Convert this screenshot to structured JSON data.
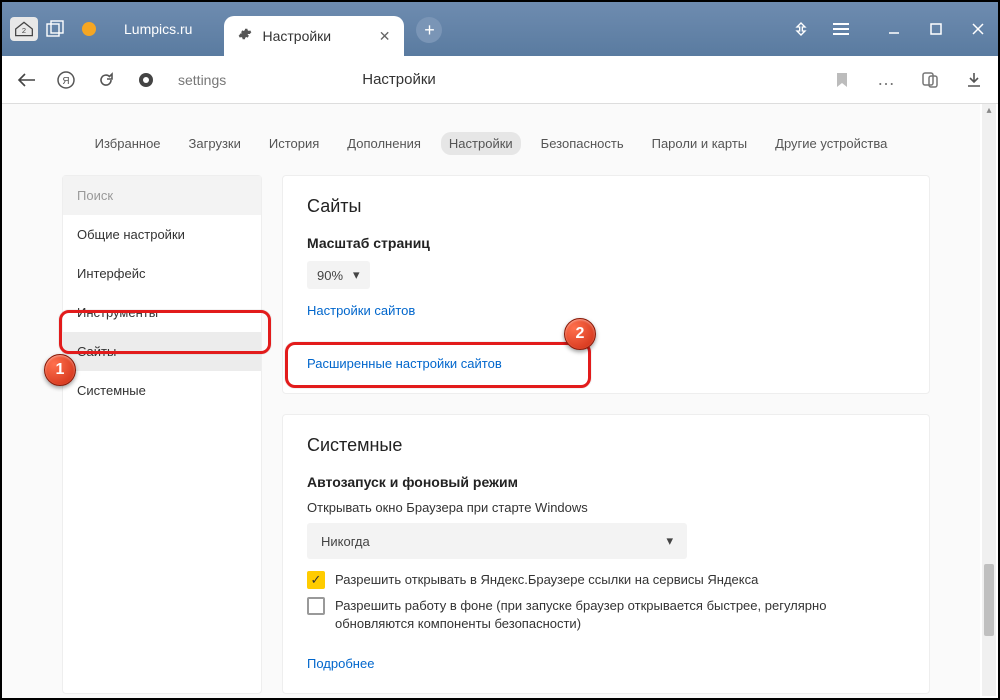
{
  "titlebar": {
    "home_badge": "2",
    "site_title": "Lumpics.ru",
    "active_tab": "Настройки"
  },
  "addressbar": {
    "url": "settings",
    "page_title": "Настройки"
  },
  "topnav": {
    "items": [
      "Избранное",
      "Загрузки",
      "История",
      "Дополнения",
      "Настройки",
      "Безопасность",
      "Пароли и карты",
      "Другие устройства"
    ],
    "active_index": 4
  },
  "sidebar": {
    "search_placeholder": "Поиск",
    "items": [
      "Общие настройки",
      "Интерфейс",
      "Инструменты",
      "Сайты",
      "Системные"
    ],
    "selected_index": 3
  },
  "sites_panel": {
    "title": "Сайты",
    "zoom_label": "Масштаб страниц",
    "zoom_value": "90%",
    "sites_settings_link": "Настройки сайтов",
    "advanced_link": "Расширенные настройки сайтов"
  },
  "system_panel": {
    "title": "Системные",
    "autostart_heading": "Автозапуск и фоновый режим",
    "autostart_label": "Открывать окно Браузера при старте Windows",
    "autostart_value": "Никогда",
    "allow_yandex_links": "Разрешить открывать в Яндекс.Браузере ссылки на сервисы Яндекса",
    "allow_background": "Разрешить работу в фоне (при запуске браузер открывается быстрее, регулярно обновляются компоненты безопасности)",
    "more_link": "Подробнее"
  },
  "annotations": {
    "badge1": "1",
    "badge2": "2"
  }
}
